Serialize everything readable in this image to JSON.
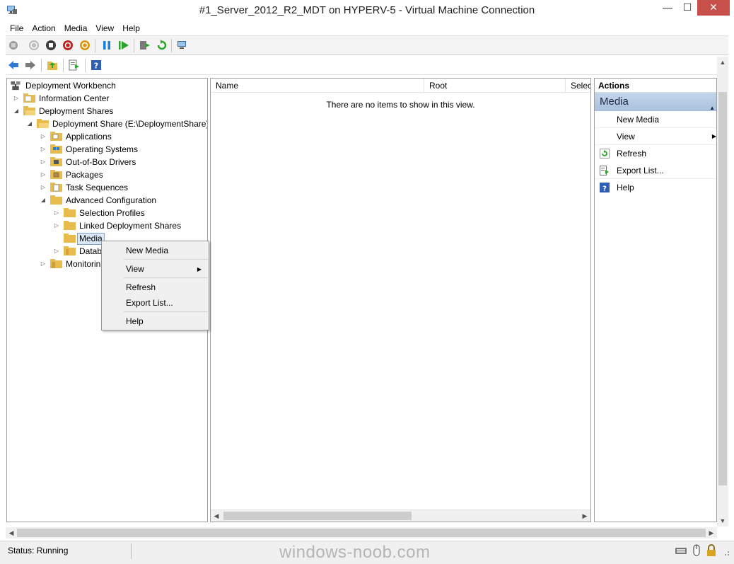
{
  "window": {
    "title": "#1_Server_2012_R2_MDT on HYPERV-5 - Virtual Machine Connection",
    "min_glyph": "—",
    "max_glyph": "☐",
    "close_glyph": "✕"
  },
  "menu": [
    "File",
    "Action",
    "Media",
    "View",
    "Help"
  ],
  "tree": {
    "items": [
      {
        "label": "Deployment Workbench",
        "expander": ""
      },
      {
        "label": "Information Center",
        "expander": "▷"
      },
      {
        "label": "Deployment Shares",
        "expander": "◢"
      },
      {
        "label": "Deployment Share (E:\\DeploymentShare)",
        "expander": "◢"
      },
      {
        "label": "Applications",
        "expander": "▷"
      },
      {
        "label": "Operating Systems",
        "expander": "▷"
      },
      {
        "label": "Out-of-Box Drivers",
        "expander": "▷"
      },
      {
        "label": "Packages",
        "expander": "▷"
      },
      {
        "label": "Task Sequences",
        "expander": "▷"
      },
      {
        "label": "Advanced Configuration",
        "expander": "◢"
      },
      {
        "label": "Selection Profiles",
        "expander": "▷"
      },
      {
        "label": "Linked Deployment Shares",
        "expander": "▷"
      },
      {
        "label": "Media",
        "expander": ""
      },
      {
        "label": "Databa",
        "expander": "▷"
      },
      {
        "label": "Monitorin",
        "expander": "▷"
      }
    ]
  },
  "list": {
    "columns": [
      "Name",
      "Root",
      "Select"
    ],
    "empty_message": "There are no items to show in this view."
  },
  "actions": {
    "title": "Actions",
    "group": "Media",
    "items": [
      {
        "label": "New Media"
      },
      {
        "label": "View"
      },
      {
        "label": "Refresh"
      },
      {
        "label": "Export List..."
      },
      {
        "label": "Help"
      }
    ]
  },
  "context_menu": {
    "items": [
      "New Media",
      "View",
      "Refresh",
      "Export List...",
      "Help"
    ]
  },
  "status": {
    "text": "Status: Running",
    "watermark": "windows-noob.com"
  },
  "colors": {
    "close_button": "#c7504b",
    "actions_header": "#b7cbe3",
    "selection": "#dbe8f7"
  },
  "icons": {
    "folder": "folder-icon",
    "back": "arrow-left-icon",
    "forward": "arrow-right-icon",
    "refresh": "refresh-icon",
    "export": "export-icon",
    "help": "help-icon"
  }
}
